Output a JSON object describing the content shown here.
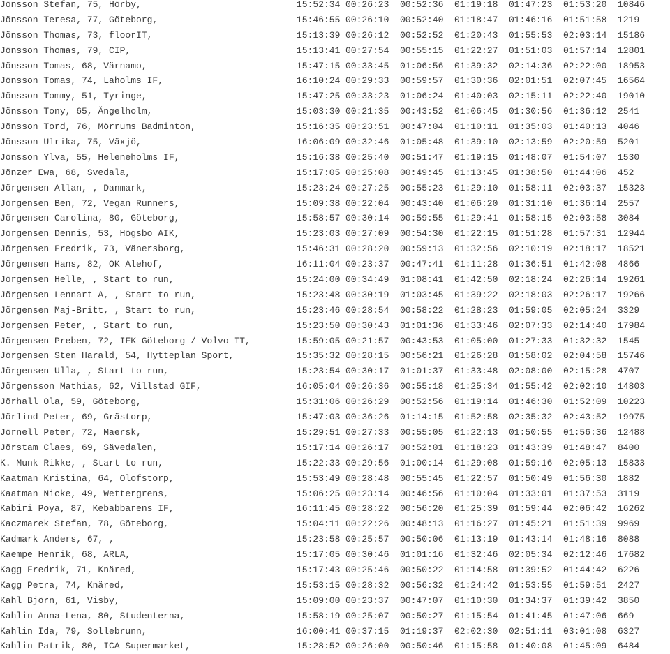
{
  "results": [
    {
      "name": "Jönsson Stefan, 75, Hörby,",
      "start": "15:52:34",
      "t1": "00:26:23",
      "t2": "00:52:36",
      "t3": "01:19:18",
      "t4": "01:47:23",
      "t5": "01:53:20",
      "bib": "10846"
    },
    {
      "name": "Jönsson Teresa, 77, Göteborg,",
      "start": "15:46:55",
      "t1": "00:26:10",
      "t2": "00:52:40",
      "t3": "01:18:47",
      "t4": "01:46:16",
      "t5": "01:51:58",
      "bib": "1219"
    },
    {
      "name": "Jönsson Thomas, 73, floorIT,",
      "start": "15:13:39",
      "t1": "00:26:12",
      "t2": "00:52:52",
      "t3": "01:20:43",
      "t4": "01:55:53",
      "t5": "02:03:14",
      "bib": "15186"
    },
    {
      "name": "Jönsson Thomas, 79, CIP,",
      "start": "15:13:41",
      "t1": "00:27:54",
      "t2": "00:55:15",
      "t3": "01:22:27",
      "t4": "01:51:03",
      "t5": "01:57:14",
      "bib": "12801"
    },
    {
      "name": "Jönsson Tomas, 68, Värnamo,",
      "start": "15:47:15",
      "t1": "00:33:45",
      "t2": "01:06:56",
      "t3": "01:39:32",
      "t4": "02:14:36",
      "t5": "02:22:00",
      "bib": "18953"
    },
    {
      "name": "Jönsson Tomas, 74, Laholms IF,",
      "start": "16:10:24",
      "t1": "00:29:33",
      "t2": "00:59:57",
      "t3": "01:30:36",
      "t4": "02:01:51",
      "t5": "02:07:45",
      "bib": "16564"
    },
    {
      "name": "Jönsson Tommy, 51, Tyringe,",
      "start": "15:47:25",
      "t1": "00:33:23",
      "t2": "01:06:24",
      "t3": "01:40:03",
      "t4": "02:15:11",
      "t5": "02:22:40",
      "bib": "19010"
    },
    {
      "name": "Jönsson Tony, 65, Ängelholm,",
      "start": "15:03:30",
      "t1": "00:21:35",
      "t2": "00:43:52",
      "t3": "01:06:45",
      "t4": "01:30:56",
      "t5": "01:36:12",
      "bib": "2541"
    },
    {
      "name": "Jönsson Tord, 76, Mörrums Badminton,",
      "start": "15:16:35",
      "t1": "00:23:51",
      "t2": "00:47:04",
      "t3": "01:10:11",
      "t4": "01:35:03",
      "t5": "01:40:13",
      "bib": "4046"
    },
    {
      "name": "Jönsson Ulrika, 75, Växjö,",
      "start": "16:06:09",
      "t1": "00:32:46",
      "t2": "01:05:48",
      "t3": "01:39:10",
      "t4": "02:13:59",
      "t5": "02:20:59",
      "bib": "5201"
    },
    {
      "name": "Jönsson Ylva, 55, Heleneholms IF,",
      "start": "15:16:38",
      "t1": "00:25:40",
      "t2": "00:51:47",
      "t3": "01:19:15",
      "t4": "01:48:07",
      "t5": "01:54:07",
      "bib": "1530"
    },
    {
      "name": "Jönzer Ewa, 68, Svedala,",
      "start": "15:17:05",
      "t1": "00:25:08",
      "t2": "00:49:45",
      "t3": "01:13:45",
      "t4": "01:38:50",
      "t5": "01:44:06",
      "bib": "452"
    },
    {
      "name": "Jörgensen Allan, , Danmark,",
      "start": "15:23:24",
      "t1": "00:27:25",
      "t2": "00:55:23",
      "t3": "01:29:10",
      "t4": "01:58:11",
      "t5": "02:03:37",
      "bib": "15323"
    },
    {
      "name": "Jörgensen Ben, 72, Vegan Runners,",
      "start": "15:09:38",
      "t1": "00:22:04",
      "t2": "00:43:40",
      "t3": "01:06:20",
      "t4": "01:31:10",
      "t5": "01:36:14",
      "bib": "2557"
    },
    {
      "name": "Jörgensen Carolina, 80, Göteborg,",
      "start": "15:58:57",
      "t1": "00:30:14",
      "t2": "00:59:55",
      "t3": "01:29:41",
      "t4": "01:58:15",
      "t5": "02:03:58",
      "bib": "3084"
    },
    {
      "name": "Jörgensen Dennis, 53, Högsbo AIK,",
      "start": "15:23:03",
      "t1": "00:27:09",
      "t2": "00:54:30",
      "t3": "01:22:15",
      "t4": "01:51:28",
      "t5": "01:57:31",
      "bib": "12944"
    },
    {
      "name": "Jörgensen Fredrik, 73, Vänersborg,",
      "start": "15:46:31",
      "t1": "00:28:20",
      "t2": "00:59:13",
      "t3": "01:32:56",
      "t4": "02:10:19",
      "t5": "02:18:17",
      "bib": "18521"
    },
    {
      "name": "Jörgensen Hans, 82, OK Alehof,",
      "start": "16:11:04",
      "t1": "00:23:37",
      "t2": "00:47:41",
      "t3": "01:11:28",
      "t4": "01:36:51",
      "t5": "01:42:08",
      "bib": "4866"
    },
    {
      "name": "Jörgensen Helle, , Start to run,",
      "start": "15:24:00",
      "t1": "00:34:49",
      "t2": "01:08:41",
      "t3": "01:42:50",
      "t4": "02:18:24",
      "t5": "02:26:14",
      "bib": "19261"
    },
    {
      "name": "Jörgensen Lennart A, , Start to run,",
      "start": "15:23:48",
      "t1": "00:30:19",
      "t2": "01:03:45",
      "t3": "01:39:22",
      "t4": "02:18:03",
      "t5": "02:26:17",
      "bib": "19266"
    },
    {
      "name": "Jörgensen Maj-Britt, , Start to run,",
      "start": "15:23:46",
      "t1": "00:28:54",
      "t2": "00:58:22",
      "t3": "01:28:23",
      "t4": "01:59:05",
      "t5": "02:05:24",
      "bib": "3329"
    },
    {
      "name": "Jörgensen Peter, , Start to run,",
      "start": "15:23:50",
      "t1": "00:30:43",
      "t2": "01:01:36",
      "t3": "01:33:46",
      "t4": "02:07:33",
      "t5": "02:14:40",
      "bib": "17984"
    },
    {
      "name": "Jörgensen Preben, 72, IFK Göteborg / Volvo IT,",
      "start": "15:59:05",
      "t1": "00:21:57",
      "t2": "00:43:53",
      "t3": "01:05:00",
      "t4": "01:27:33",
      "t5": "01:32:32",
      "bib": "1545"
    },
    {
      "name": "Jörgensen Sten Harald, 54, Hytteplan Sport,",
      "start": "15:35:32",
      "t1": "00:28:15",
      "t2": "00:56:21",
      "t3": "01:26:28",
      "t4": "01:58:02",
      "t5": "02:04:58",
      "bib": "15746"
    },
    {
      "name": "Jörgensen Ulla, , Start to run,",
      "start": "15:23:54",
      "t1": "00:30:17",
      "t2": "01:01:37",
      "t3": "01:33:48",
      "t4": "02:08:00",
      "t5": "02:15:28",
      "bib": "4707"
    },
    {
      "name": "Jörgensson Mathias, 62, Villstad GIF,",
      "start": "16:05:04",
      "t1": "00:26:36",
      "t2": "00:55:18",
      "t3": "01:25:34",
      "t4": "01:55:42",
      "t5": "02:02:10",
      "bib": "14803"
    },
    {
      "name": "Jörhall Ola, 59, Göteborg,",
      "start": "15:31:06",
      "t1": "00:26:29",
      "t2": "00:52:56",
      "t3": "01:19:14",
      "t4": "01:46:30",
      "t5": "01:52:09",
      "bib": "10223"
    },
    {
      "name": "Jörlind Peter, 69, Grästorp,",
      "start": "15:47:03",
      "t1": "00:36:26",
      "t2": "01:14:15",
      "t3": "01:52:58",
      "t4": "02:35:32",
      "t5": "02:43:52",
      "bib": "19975"
    },
    {
      "name": "Jörnell Peter, 72, Maersk,",
      "start": "15:29:51",
      "t1": "00:27:33",
      "t2": "00:55:05",
      "t3": "01:22:13",
      "t4": "01:50:55",
      "t5": "01:56:36",
      "bib": "12488"
    },
    {
      "name": "Jörstam Claes, 69, Sävedalen,",
      "start": "15:17:14",
      "t1": "00:26:17",
      "t2": "00:52:01",
      "t3": "01:18:23",
      "t4": "01:43:39",
      "t5": "01:48:47",
      "bib": "8400"
    },
    {
      "name": "K. Munk Rikke, , Start to run,",
      "start": "15:22:33",
      "t1": "00:29:56",
      "t2": "01:00:14",
      "t3": "01:29:08",
      "t4": "01:59:16",
      "t5": "02:05:13",
      "bib": "15833"
    },
    {
      "name": "Kaatman Kristina, 64, Olofstorp,",
      "start": "15:53:49",
      "t1": "00:28:48",
      "t2": "00:55:45",
      "t3": "01:22:57",
      "t4": "01:50:49",
      "t5": "01:56:30",
      "bib": "1882"
    },
    {
      "name": "Kaatman Nicke, 49, Wettergrens,",
      "start": "15:06:25",
      "t1": "00:23:14",
      "t2": "00:46:56",
      "t3": "01:10:04",
      "t4": "01:33:01",
      "t5": "01:37:53",
      "bib": "3119"
    },
    {
      "name": "Kabiri Poya, 87, Kebabbarens IF,",
      "start": "16:11:45",
      "t1": "00:28:22",
      "t2": "00:56:20",
      "t3": "01:25:39",
      "t4": "01:59:44",
      "t5": "02:06:42",
      "bib": "16262"
    },
    {
      "name": "Kaczmarek Stefan, 78, Göteborg,",
      "start": "15:04:11",
      "t1": "00:22:26",
      "t2": "00:48:13",
      "t3": "01:16:27",
      "t4": "01:45:21",
      "t5": "01:51:39",
      "bib": "9969"
    },
    {
      "name": "Kadmark Anders, 67, ,",
      "start": "15:23:58",
      "t1": "00:25:57",
      "t2": "00:50:06",
      "t3": "01:13:19",
      "t4": "01:43:14",
      "t5": "01:48:16",
      "bib": "8088"
    },
    {
      "name": "Kaempe Henrik, 68, ARLA,",
      "start": "15:17:05",
      "t1": "00:30:46",
      "t2": "01:01:16",
      "t3": "01:32:46",
      "t4": "02:05:34",
      "t5": "02:12:46",
      "bib": "17682"
    },
    {
      "name": "Kagg Fredrik, 71, Knäred,",
      "start": "15:17:43",
      "t1": "00:25:46",
      "t2": "00:50:22",
      "t3": "01:14:58",
      "t4": "01:39:52",
      "t5": "01:44:42",
      "bib": "6226"
    },
    {
      "name": "Kagg Petra, 74, Knäred,",
      "start": "15:53:15",
      "t1": "00:28:32",
      "t2": "00:56:32",
      "t3": "01:24:42",
      "t4": "01:53:55",
      "t5": "01:59:51",
      "bib": "2427"
    },
    {
      "name": "Kahl Björn, 61, Visby,",
      "start": "15:09:00",
      "t1": "00:23:37",
      "t2": "00:47:07",
      "t3": "01:10:30",
      "t4": "01:34:37",
      "t5": "01:39:42",
      "bib": "3850"
    },
    {
      "name": "Kahlin Anna-Lena, 80, Studenterna,",
      "start": "15:58:19",
      "t1": "00:25:07",
      "t2": "00:50:27",
      "t3": "01:15:54",
      "t4": "01:41:45",
      "t5": "01:47:06",
      "bib": "669"
    },
    {
      "name": "Kahlin Ida, 79, Sollebrunn,",
      "start": "16:00:41",
      "t1": "00:37:15",
      "t2": "01:19:37",
      "t3": "02:02:30",
      "t4": "02:51:11",
      "t5": "03:01:08",
      "bib": "6327"
    },
    {
      "name": "Kahlin Patrik, 80, ICA Supermarket,",
      "start": "15:28:52",
      "t1": "00:26:00",
      "t2": "00:50:46",
      "t3": "01:15:58",
      "t4": "01:40:08",
      "t5": "01:45:09",
      "bib": "6484"
    }
  ]
}
